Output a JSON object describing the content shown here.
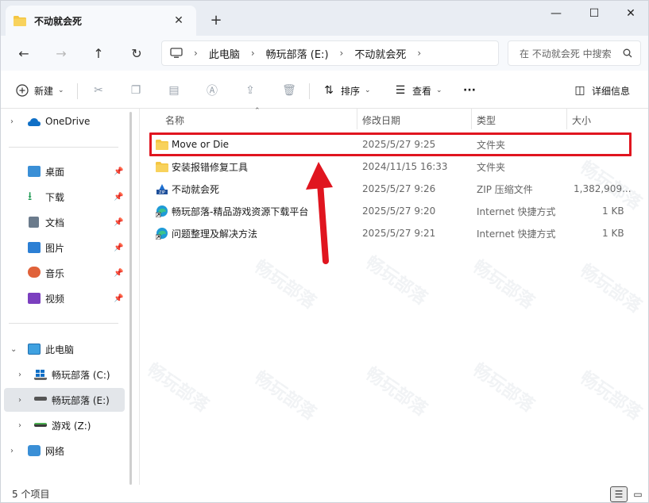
{
  "tab": {
    "title": "不动就会死",
    "close": "✕",
    "new_tab": "+"
  },
  "window_controls": {
    "minimize": "—",
    "maximize": "☐",
    "close": "✕"
  },
  "nav": {
    "back": "←",
    "forward": "→",
    "up": "↑",
    "refresh": "↻"
  },
  "breadcrumb": [
    "此电脑",
    "畅玩部落 (E:)",
    "不动就会死"
  ],
  "search": {
    "placeholder": "在 不动就会死 中搜索"
  },
  "commands": {
    "new": "新建",
    "sort": "排序",
    "view": "查看",
    "more": "···",
    "details": "详细信息"
  },
  "sidebar": {
    "onedrive": "OneDrive",
    "quick": [
      {
        "label": "桌面",
        "icon": "desktop-icon",
        "color": "#3a8fd6"
      },
      {
        "label": "下载",
        "icon": "download-icon",
        "color": "#1d9a52"
      },
      {
        "label": "文档",
        "icon": "document-icon",
        "color": "#6b7b8c"
      },
      {
        "label": "图片",
        "icon": "pictures-icon",
        "color": "#2c7fd4"
      },
      {
        "label": "音乐",
        "icon": "music-icon",
        "color": "#e0623a"
      },
      {
        "label": "视频",
        "icon": "video-icon",
        "color": "#7b3fbf"
      }
    ],
    "this_pc": "此电脑",
    "drives": [
      {
        "label": "畅玩部落 (C:)",
        "icon": "windows-drive-icon"
      },
      {
        "label": "畅玩部落 (E:)",
        "icon": "drive-icon",
        "selected": true
      },
      {
        "label": "游戏 (Z:)",
        "icon": "drive-icon"
      }
    ],
    "network": "网络"
  },
  "columns": {
    "name": "名称",
    "modified": "修改日期",
    "type": "类型",
    "size": "大小"
  },
  "files": [
    {
      "name": "Move or Die",
      "modified": "2025/5/27 9:25",
      "type": "文件夹",
      "size": "",
      "icon": "folder-icon"
    },
    {
      "name": "安装报错修复工具",
      "modified": "2024/11/15 16:33",
      "type": "文件夹",
      "size": "",
      "icon": "folder-icon"
    },
    {
      "name": "不动就会死",
      "modified": "2025/5/27 9:26",
      "type": "ZIP 压缩文件",
      "size": "1,382,909...",
      "icon": "zip-icon"
    },
    {
      "name": "畅玩部落-精品游戏资源下载平台",
      "modified": "2025/5/27 9:20",
      "type": "Internet 快捷方式",
      "size": "1 KB",
      "icon": "edge-shortcut-icon"
    },
    {
      "name": "问题整理及解决方法",
      "modified": "2025/5/27 9:21",
      "type": "Internet 快捷方式",
      "size": "1 KB",
      "icon": "edge-shortcut-icon"
    }
  ],
  "status": {
    "count": "5 个项目"
  },
  "watermark": "畅玩部落",
  "colors": {
    "accent": "#0067c0",
    "highlight": "#e0151f",
    "folder": "#f4c542"
  }
}
